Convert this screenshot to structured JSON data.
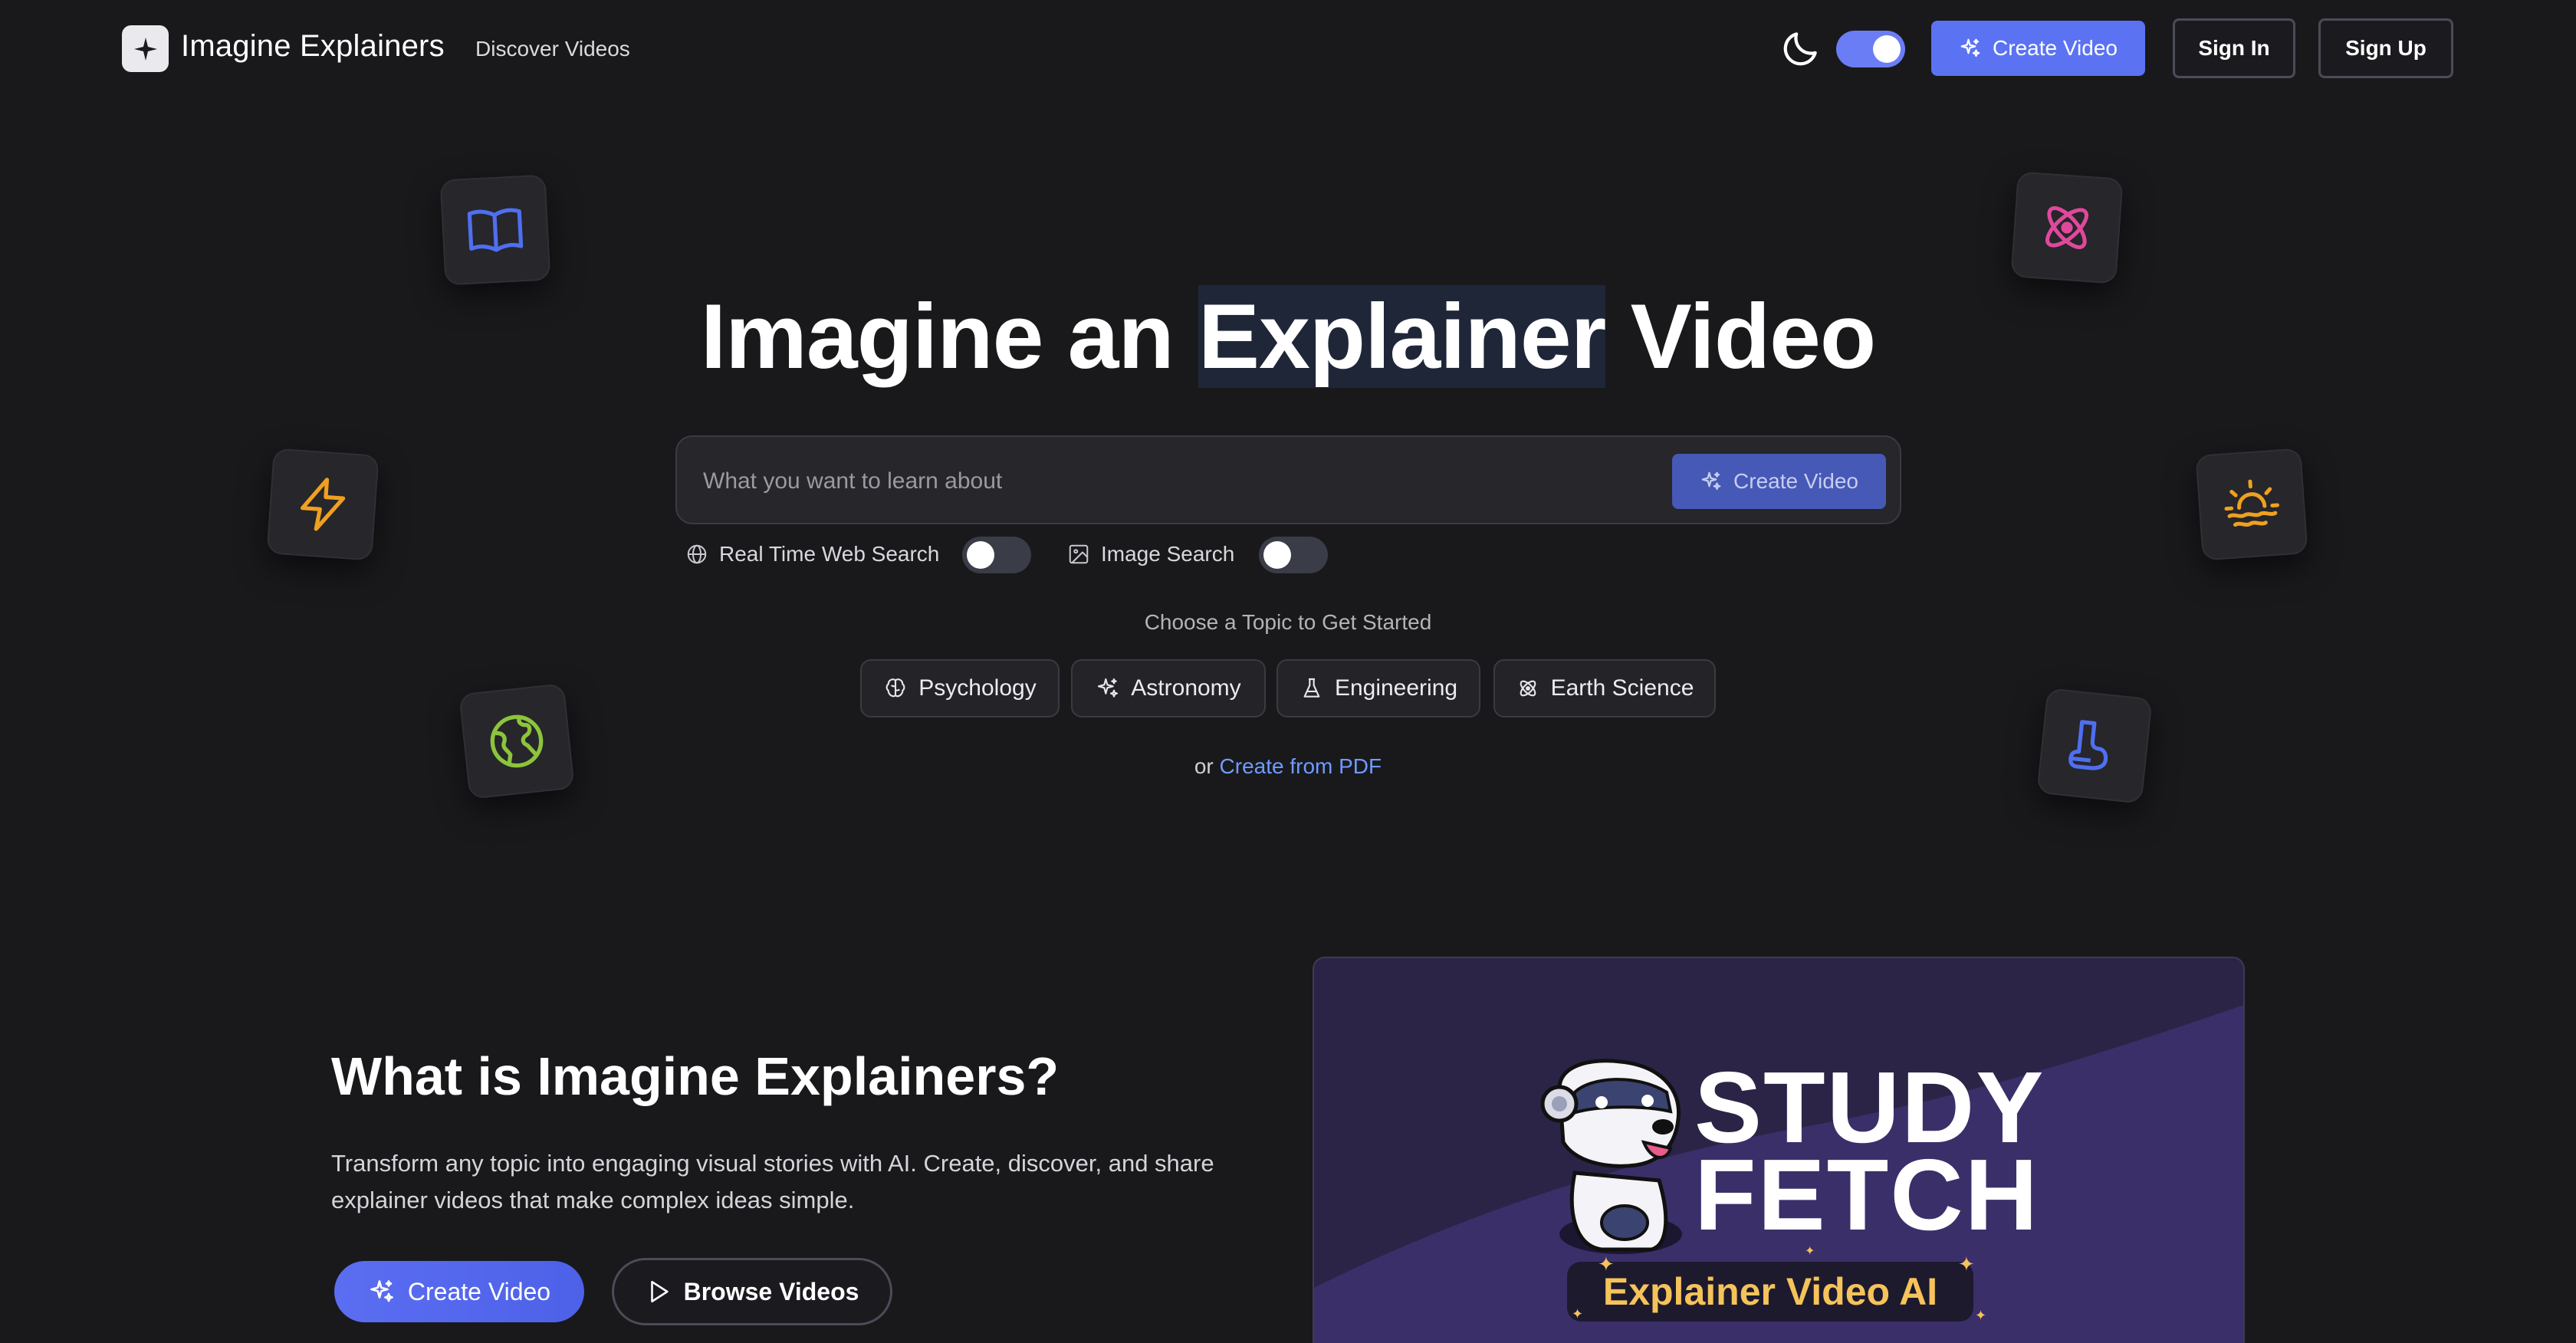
{
  "header": {
    "brand": "Imagine Explainers",
    "nav_discover": "Discover Videos",
    "create_label": "Create Video",
    "signin_label": "Sign In",
    "signup_label": "Sign Up",
    "theme_toggle_on": true
  },
  "hero": {
    "title_part1": "Imagine an ",
    "title_highlight": "Explainer",
    "title_part2": " Video",
    "search_placeholder": "What you want to learn about",
    "search_button": "Create Video",
    "web_search_label": "Real Time Web Search",
    "web_search_on": false,
    "image_search_label": "Image Search",
    "image_search_on": false,
    "choose_label": "Choose a Topic to Get Started",
    "topics": [
      "Psychology",
      "Astronomy",
      "Engineering",
      "Earth Science"
    ],
    "pdf_prefix": "or ",
    "pdf_link": "Create from PDF"
  },
  "floating_icons": [
    "book-icon",
    "atom-icon",
    "lightning-icon",
    "sunrise-icon",
    "globe-icon",
    "magnet-icon"
  ],
  "colors": {
    "background": "#19191c",
    "accent": "#5b73f2",
    "link": "#6f9bff",
    "book": "#4f6ff0",
    "atom": "#e0489b",
    "lightning": "#f0a020",
    "sunrise": "#f0a020",
    "globe": "#8cc43c",
    "magnet": "#4f6ff0",
    "badge_text": "#f5c35a"
  },
  "section": {
    "title": "What is Imagine Explainers?",
    "description": "Transform any topic into engaging visual stories with AI. Create, discover, and share explainer videos that make complex ideas simple.",
    "create_label": "Create Video",
    "browse_label": "Browse Videos"
  },
  "video": {
    "line1": "STUDY",
    "line2": "FETCH",
    "badge": "Explainer Video AI"
  }
}
